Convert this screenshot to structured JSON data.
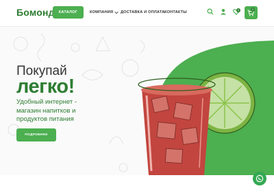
{
  "header": {
    "logo": "Бомонд",
    "catalog_label": "КАТАЛОГ",
    "nav": {
      "company": "КОМПАНИЯ",
      "delivery": "ДОСТАВКА И ОПЛАТА",
      "contacts": "КОНТАКТЫ"
    },
    "favorites_count": "0",
    "cart_count": "0"
  },
  "hero": {
    "title_line1": "Покупай",
    "title_line2": "легко!",
    "subtitle": "Удобный интернет - магазин напитков и продуктов питания",
    "button_label": "ПОДРОБНЕЕ"
  },
  "colors": {
    "brand_green": "#4caf50",
    "dark_green": "#2e7d32"
  },
  "icons": [
    "search-icon",
    "user-icon",
    "heart-icon",
    "cart-icon",
    "whatsapp-icon",
    "chevron-down-icon"
  ]
}
